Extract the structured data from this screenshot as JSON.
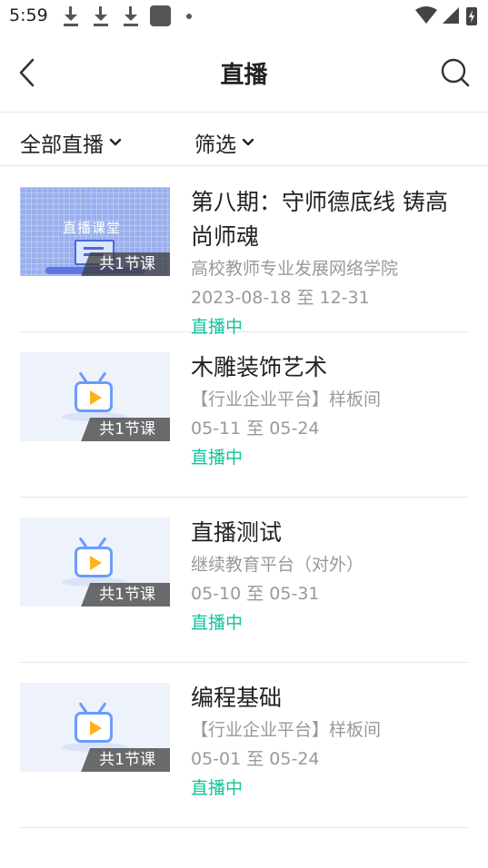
{
  "status_bar": {
    "time": "5:59"
  },
  "nav": {
    "title": "直播"
  },
  "filters": {
    "all": "全部直播",
    "filter": "筛选"
  },
  "courses": [
    {
      "thumb_type": "classroom",
      "thumb_text": "直播课堂",
      "badge": "共1节课",
      "title": "第八期：守师德底线 铸高尚师魂",
      "org": "高校教师专业发展网络学院",
      "date": "2023-08-18 至 12-31",
      "status": "直播中"
    },
    {
      "thumb_type": "tv",
      "badge": "共1节课",
      "title": "木雕装饰艺术",
      "org": "【行业企业平台】样板间",
      "date": "05-11 至 05-24",
      "status": "直播中"
    },
    {
      "thumb_type": "tv",
      "badge": "共1节课",
      "title": "直播测试",
      "org": "继续教育平台（对外）",
      "date": "05-10 至 05-31",
      "status": "直播中"
    },
    {
      "thumb_type": "tv",
      "badge": "共1节课",
      "title": "编程基础",
      "org": "【行业企业平台】样板间",
      "date": "05-01 至 05-24",
      "status": "直播中"
    }
  ],
  "colors": {
    "accent_live": "#14c29a",
    "meta_text": "#999999"
  }
}
